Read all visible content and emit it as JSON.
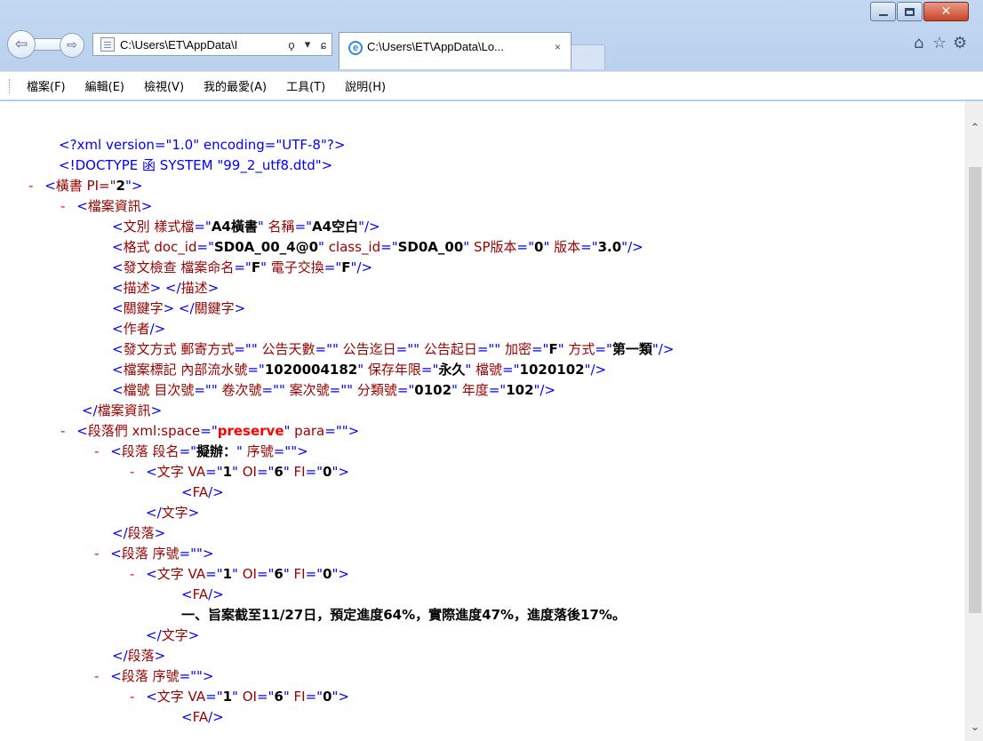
{
  "window": {
    "address": "C:\\Users\\ET\\AppData\\I",
    "tab_title": "C:\\Users\\ET\\AppData\\Lo...",
    "tab_close": "×",
    "address_search_icon": "ϙ",
    "address_dropdown_icon": "▾",
    "address_refresh_icon": "ɕ"
  },
  "menu": [
    "檔案(F)",
    "編輯(E)",
    "檢視(V)",
    "我的最愛(A)",
    "工具(T)",
    "說明(H)"
  ],
  "lines": {
    "l1": "<?xml version=\"1.0\" encoding=\"UTF-8\"?>",
    "l2": "<!DOCTYPE 函 SYSTEM \"99_2_utf8.dtd\">",
    "l3a": "<",
    "l3b": "橫書",
    "l3c": " PI=\"",
    "l3d": "2",
    "l3e": "\">",
    "l4a": "<",
    "l4b": "檔案資訊",
    "l4c": ">",
    "l5a": "<",
    "l5b": "文別 樣式檔",
    "l5c": "=\"",
    "l5d": "A4橫書",
    "l5e": "\" ",
    "l5f": "名稱",
    "l5g": "=\"",
    "l5h": "A4空白",
    "l5i": "\"/>",
    "l6a": "<",
    "l6b": "格式 doc_id",
    "l6c": "=\"",
    "l6d": "SD0A_00_4@0",
    "l6e": "\" ",
    "l6f": "class_id",
    "l6g": "=\"",
    "l6h": "SD0A_00",
    "l6i": "\" ",
    "l6j": "SP版本",
    "l6k": "=\"",
    "l6l": "0",
    "l6m": "\" ",
    "l6n": "版本",
    "l6o": "=\"",
    "l6p": "3.0",
    "l6q": "\"/>",
    "l7a": "<",
    "l7b": "發文檢查 檔案命名",
    "l7c": "=\"",
    "l7d": "F",
    "l7e": "\" ",
    "l7f": "電子交換",
    "l7g": "=\"",
    "l7h": "F",
    "l7i": "\"/>",
    "l8a": "<",
    "l8b": "描述",
    "l8c": "> </",
    "l8d": "描述",
    "l8e": ">",
    "l9a": "<",
    "l9b": "關鍵字",
    "l9c": "> </",
    "l9d": "關鍵字",
    "l9e": ">",
    "l10a": "<",
    "l10b": "作者",
    "l10c": "/>",
    "l11a": "<",
    "l11b": "發文方式 郵寄方式",
    "l11c": "=\"\" ",
    "l11d": "公告天數",
    "l11e": "=\"\" ",
    "l11f": "公告迄日",
    "l11g": "=\"\" ",
    "l11h": "公告起日",
    "l11i": "=\"\" ",
    "l11j": "加密",
    "l11k": "=\"",
    "l11l": "F",
    "l11m": "\" ",
    "l11n": "方式",
    "l11o": "=\"",
    "l11p": "第一類",
    "l11q": "\"/>",
    "l12a": "<",
    "l12b": "檔案標記 內部流水號",
    "l12c": "=\"",
    "l12d": "1020004182",
    "l12e": "\" ",
    "l12f": "保存年限",
    "l12g": "=\"",
    "l12h": "永久",
    "l12i": "\" ",
    "l12j": "檔號",
    "l12k": "=\"",
    "l12l": "1020102",
    "l12m": "\"/>",
    "l13a": "<",
    "l13b": "檔號 目次號",
    "l13c": "=\"\" ",
    "l13d": "卷次號",
    "l13e": "=\"\" ",
    "l13f": "案次號",
    "l13g": "=\"\" ",
    "l13h": "分類號",
    "l13i": "=\"",
    "l13j": "0102",
    "l13k": "\" ",
    "l13l": "年度",
    "l13m": "=\"",
    "l13n": "102",
    "l13o": "\"/>",
    "l14a": "</",
    "l14b": "檔案資訊",
    "l14c": ">",
    "l15a": "<",
    "l15b": "段落們 xml:space",
    "l15c": "=\"",
    "l15d": "preserve",
    "l15e": "\" ",
    "l15f": "para",
    "l15g": "=\"\">",
    "l16a": "<",
    "l16b": "段落 段名",
    "l16c": "=\"",
    "l16d": "擬辦：",
    "l16e": "\" ",
    "l16f": "序號",
    "l16g": "=\"\">",
    "l17a": "<",
    "l17b": "文字 VA",
    "l17c": "=\"",
    "l17d": "1",
    "l17e": "\" ",
    "l17f": "OI",
    "l17g": "=\"",
    "l17h": "6",
    "l17i": "\" ",
    "l17j": "FI",
    "l17k": "=\"",
    "l17l": "0",
    "l17m": "\">",
    "l18a": "<",
    "l18b": "FA",
    "l18c": "/>",
    "l19a": "</",
    "l19b": "文字",
    "l19c": ">",
    "l20a": "</",
    "l20b": "段落",
    "l20c": ">",
    "l21a": "<",
    "l21b": "段落 序號",
    "l21c": "=\"\">",
    "l22a": "<",
    "l22b": "文字 VA",
    "l22c": "=\"",
    "l22d": "1",
    "l22e": "\" ",
    "l22f": "OI",
    "l22g": "=\"",
    "l22h": "6",
    "l22i": "\" ",
    "l22j": "FI",
    "l22k": "=\"",
    "l22l": "0",
    "l22m": "\">",
    "l23a": "<",
    "l23b": "FA",
    "l23c": "/>",
    "l24": "一、旨案截至11/27日，預定進度64%，實際進度47%，進度落後17%。",
    "l25a": "</",
    "l25b": "文字",
    "l25c": ">",
    "l26a": "</",
    "l26b": "段落",
    "l26c": ">",
    "l27a": "<",
    "l27b": "段落 序號",
    "l27c": "=\"\">",
    "l28a": "<",
    "l28b": "文字 VA",
    "l28c": "=\"",
    "l28d": "1",
    "l28e": "\" ",
    "l28f": "OI",
    "l28g": "=\"",
    "l28h": "6",
    "l28i": "\" ",
    "l28j": "FI",
    "l28k": "=\"",
    "l28l": "0",
    "l28m": "\">",
    "l29a": "<",
    "l29b": "FA",
    "l29c": "/>",
    "minus": "-"
  },
  "icons": {
    "back": "back-arrow-icon",
    "forward": "forward-arrow-icon",
    "home": "home-icon",
    "favorites": "star-icon",
    "tools": "gear-icon"
  }
}
